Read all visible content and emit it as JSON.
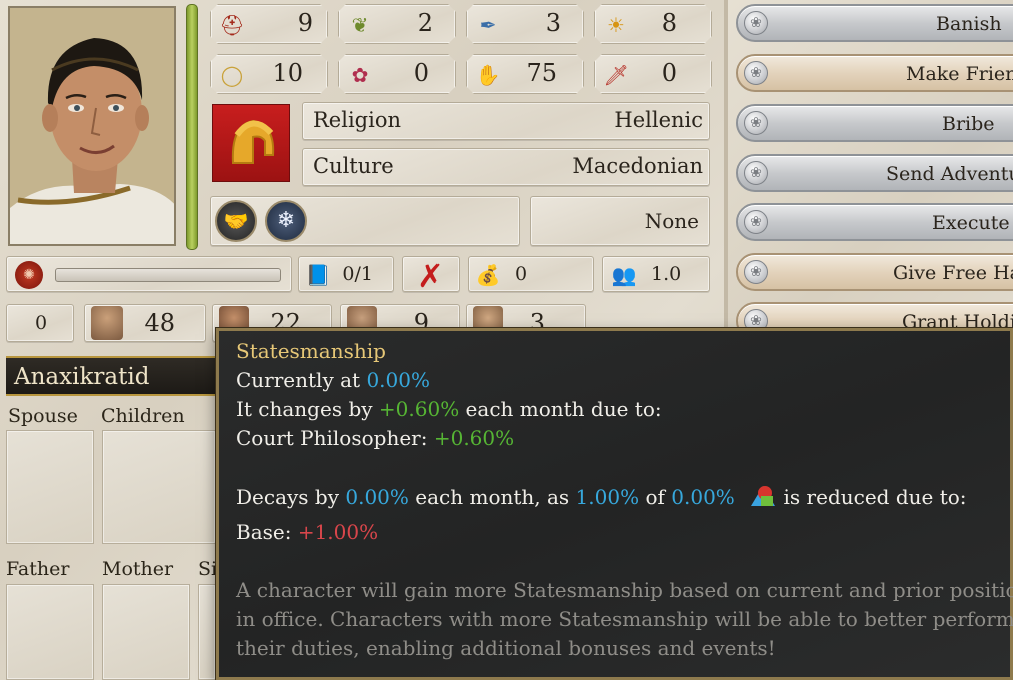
{
  "stats_row1": [
    {
      "icon": "helmet-icon",
      "value": "9"
    },
    {
      "icon": "laurel-icon",
      "value": "2"
    },
    {
      "icon": "scroll-pen-icon",
      "value": "3"
    },
    {
      "icon": "sun-icon",
      "value": "8"
    }
  ],
  "stats_row2": [
    {
      "icon": "wreath-icon",
      "value": "10"
    },
    {
      "icon": "rose-icon",
      "value": "0"
    },
    {
      "icon": "hand-icon",
      "value": "75"
    },
    {
      "icon": "dagger-icon",
      "value": "0"
    }
  ],
  "religion": {
    "label": "Religion",
    "value": "Hellenic"
  },
  "culture": {
    "label": "Culture",
    "value": "Macedonian"
  },
  "party": {
    "value": "None"
  },
  "row_resources": {
    "books": "0/1",
    "gold": "0",
    "pop": "1.0"
  },
  "row_family_stats": {
    "first": "0",
    "second": "48",
    "third": "22",
    "fourth": "9",
    "fifth": "3"
  },
  "character": {
    "name": "Anaxikratid"
  },
  "family_labels": {
    "spouse": "Spouse",
    "children": "Children",
    "father": "Father",
    "mother": "Mother",
    "siblings": "Si"
  },
  "actions": [
    {
      "label": "Banish",
      "style": "silver"
    },
    {
      "label": "Make Frienc",
      "style": "warm"
    },
    {
      "label": "Bribe",
      "style": "silver"
    },
    {
      "label": "Send Adventu",
      "style": "silver"
    },
    {
      "label": "Execute",
      "style": "silver"
    },
    {
      "label": "Give Free Har",
      "style": "warm"
    },
    {
      "label": "Grant Holdir",
      "style": "warm"
    }
  ],
  "tooltip": {
    "title": "Statesmanship",
    "current_prefix": "Currently at ",
    "current_value": "0.00%",
    "change_prefix": "It changes by ",
    "change_value": "+0.60%",
    "change_suffix": " each month due to:",
    "source_label": "Court Philosopher: ",
    "source_value": "+0.60%",
    "decay_prefix": "Decays by ",
    "decay_value": "0.00%",
    "decay_mid1": " each month, as ",
    "decay_rate": "1.00%",
    "decay_mid2": " of ",
    "decay_base": "0.00%",
    "decay_suffix": " is reduced due to:",
    "base_label": "Base: ",
    "base_value": "+1.00%",
    "desc_line1": "A character will gain more Statesmanship based on current and prior positions",
    "desc_line2": "in office. Characters with more Statesmanship will be able to better perform",
    "desc_line3": "their duties, enabling additional bonuses and events!"
  },
  "colors": {
    "accent_gold": "#e6c777",
    "value_blue": "#37a8dc",
    "positive_green": "#56b534",
    "negative_red": "#d8464b"
  }
}
